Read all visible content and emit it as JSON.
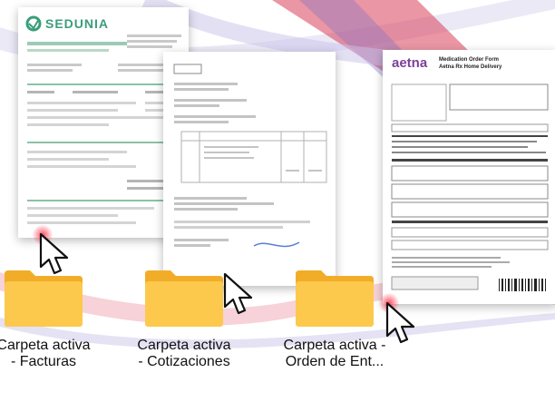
{
  "colors": {
    "background": "#ffffff",
    "ribbon_red": "#d9405a",
    "ribbon_purple": "#7b6fc8",
    "folder_body": "#fcc94d",
    "folder_tab": "#f2ad28",
    "brand_green": "#3a9e7a",
    "aetna_purple": "#7d3f98"
  },
  "documents": {
    "invoice": {
      "brand": "SEDUNIA"
    },
    "quotation": {},
    "order_form": {
      "brand": "aetna",
      "title_line1": "Medication Order Form",
      "title_line2": "Aetna Rx Home Delivery"
    }
  },
  "folders": [
    {
      "label": "Carpeta activa - Facturas",
      "icon": "folder-icon"
    },
    {
      "label": "Carpeta activa - Cotizaciones",
      "icon": "folder-icon"
    },
    {
      "label": "Carpeta activa - Orden de Ent...",
      "icon": "folder-icon"
    }
  ],
  "cursors": [
    {
      "icon": "pointer-cursor-icon"
    },
    {
      "icon": "pointer-cursor-icon"
    },
    {
      "icon": "pointer-cursor-icon"
    }
  ]
}
